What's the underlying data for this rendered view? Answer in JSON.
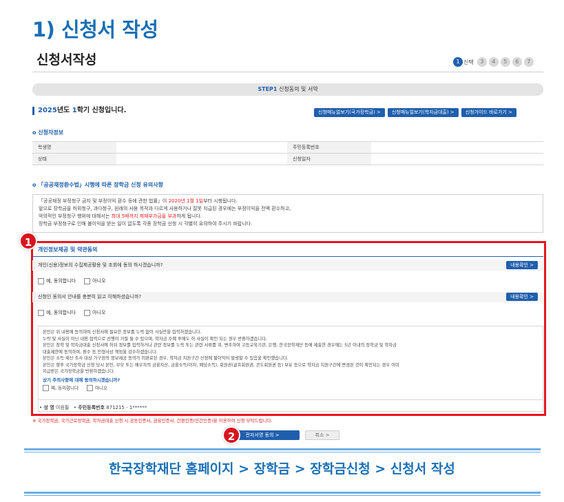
{
  "heading": "1) 신청서 작성",
  "page_title": "신청서작성",
  "steps": {
    "active": "1",
    "active_label": "신택",
    "others": [
      "3",
      "4",
      "5",
      "6",
      "7"
    ]
  },
  "step_bar": {
    "prefix": "STEP1",
    "text": "신청동의 및 서약"
  },
  "year_line": {
    "year": "2025",
    "mid": "년도 ",
    "term": "1",
    "suffix": "학기 신청입니다."
  },
  "top_buttons": [
    "신청매뉴얼보기(국가장학금) >",
    "신청매뉴얼보기(학자금대출) >",
    "신청가이드 바로가기 >"
  ],
  "applicant": {
    "title": "신청자정보",
    "rows": [
      {
        "label1": "학생명",
        "value1": "",
        "label2": "주민등록번호",
        "value2": ""
      },
      {
        "label1": "상태",
        "value1": "",
        "label2": "신청일자",
        "value2": ""
      }
    ]
  },
  "notice": {
    "title": "「공공재정환수법」시행에 따른 장학금 신청 유의사항",
    "line1_a": "「공공재정 부정청구 금지 및 부정이익 환수 등에 관한 법률」이 ",
    "line1_b": "2020년 1월 1일",
    "line1_c": "부터 시행됩니다.",
    "line2": "앞으로 장학금을 허위청구, 과다청구, 원래의 사용 목적과 다르게 사용하거나 잘못 지급된 경우에는 부정이익을 전액 환수하고,",
    "line3_a": "악의적인 부정청구 행위에 대해서는 ",
    "line3_b": "최대 5배까지 제재부가금을 부과",
    "line3_c": "하게 됩니다.",
    "line4": "장학금 부정청구로 인해 불이익을 받는 일이 없도록 각종 장학금 신청 시 각별히 유의하여 주시기 바랍니다."
  },
  "agreement": {
    "title": "개인정보제공 및 약관동의",
    "q1": "개인(신용)정보의 수집제공활용 및 조회에 동의 하시겠습니까?",
    "q2": "신청인 동의서 안내를 충분히 읽고 이해하셨습니까?",
    "confirm": "내용확인 >",
    "yes": "예, 동의합니다",
    "no": "아니오",
    "yes_short": "예, 동의합니다",
    "statement": [
      "본인은 위 내용에 동의하며 신청서에 필요한 정보를 누락 없이 사실만을 입력하겠습니다.",
      "누락 및 사실이 아닌 내용 입력으로 선행이 거절 될 수 있으며, 학자금 수혜 후에도 허 사실이 확인 되는 경우 반환하겠습니다.",
      "본인은 장학 및 학자금대출 신청서에 허위 정보를 입력하거나 관련 정보를 누락 또는 관련 서류를 위, 변조하여 고등교육기관, 은행, 한국장학재단 등에 제출한 경우에는 5년 이내의 장학금 및 학자금",
      "대출제한에 동의하며, 환수 등 민형사상 책임을 감수하겠습니다.",
      "본인은 소득·재산 조사 대상 가구원의 정보제공 동의가 미완료된 경우, 학자금 지원구간 산정에 불이익이 발생할 수 있음을 확인했습니다.",
      "본인은 향후 국가장학금 신청 당시 본인, 부모 또는 배우자의 금융자산, 금융소득(이자, 배당소득), 회원권(골프회원권, 콘도회원권 등) 보유 등으로 학자금 지원구간에 변경된 것이 확인되는 경우 이미",
      "지급받은 국가장학금을 반환하겠습니다."
    ],
    "statement_q": "상기 주의사항에 대해 동의하시겠습니까?",
    "sign_name_label": "성 명",
    "sign_name": "이원필",
    "sign_id_label": "주민등록번호",
    "sign_id": "871215 - 1******"
  },
  "footnote": "※ 국가장학금, 국가근로장학금, 학자금대출 신청 시 공동인증서, 금융인증서, 간편인증(민간인증)을 이용하여 신청 부탁드립니다.",
  "submit_label": "전자서명 동의  >",
  "cancel_label": "취소  >",
  "badges": [
    "1",
    "2"
  ],
  "banner": "한국장학재단 홈페이지 > 장학금 > 장학금신청 > 신청서 작성"
}
